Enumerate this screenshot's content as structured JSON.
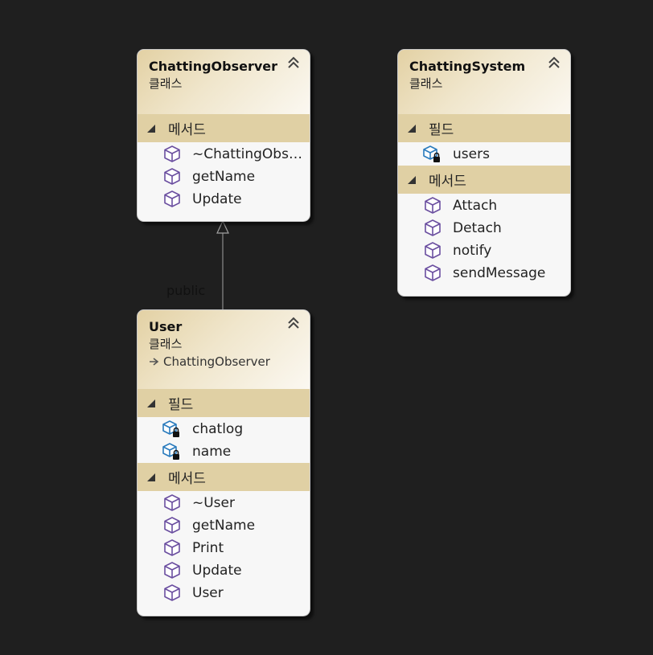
{
  "diagram": {
    "classes": {
      "chatting_observer": {
        "name": "ChattingObserver",
        "kind": "클래스",
        "sections": {
          "methods": {
            "label": "메서드",
            "items": [
              "~ChattingObse...",
              "getName",
              "Update"
            ]
          }
        }
      },
      "chatting_system": {
        "name": "ChattingSystem",
        "kind": "클래스",
        "sections": {
          "fields": {
            "label": "필드",
            "items": [
              "users"
            ]
          },
          "methods": {
            "label": "메서드",
            "items": [
              "Attach",
              "Detach",
              "notify",
              "sendMessage"
            ]
          }
        }
      },
      "user": {
        "name": "User",
        "kind": "클래스",
        "base": "ChattingObserver",
        "sections": {
          "fields": {
            "label": "필드",
            "items": [
              "chatlog",
              "name"
            ]
          },
          "methods": {
            "label": "메서드",
            "items": [
              "~User",
              "getName",
              "Print",
              "Update",
              "User"
            ]
          }
        }
      }
    },
    "inheritance": {
      "label": "public"
    },
    "icons": {
      "method": "method-cube-icon",
      "field": "private-field-icon",
      "collapse": "double-chevron-up-icon",
      "section_toggle": "triangle-expander-icon",
      "base_arrow": "inherit-arrow-icon"
    },
    "colors": {
      "background": "#1f1f1f",
      "section_header": "#e0d0a4",
      "method_icon": "#6b4fa0",
      "field_icon": "#2a7bbd"
    }
  }
}
